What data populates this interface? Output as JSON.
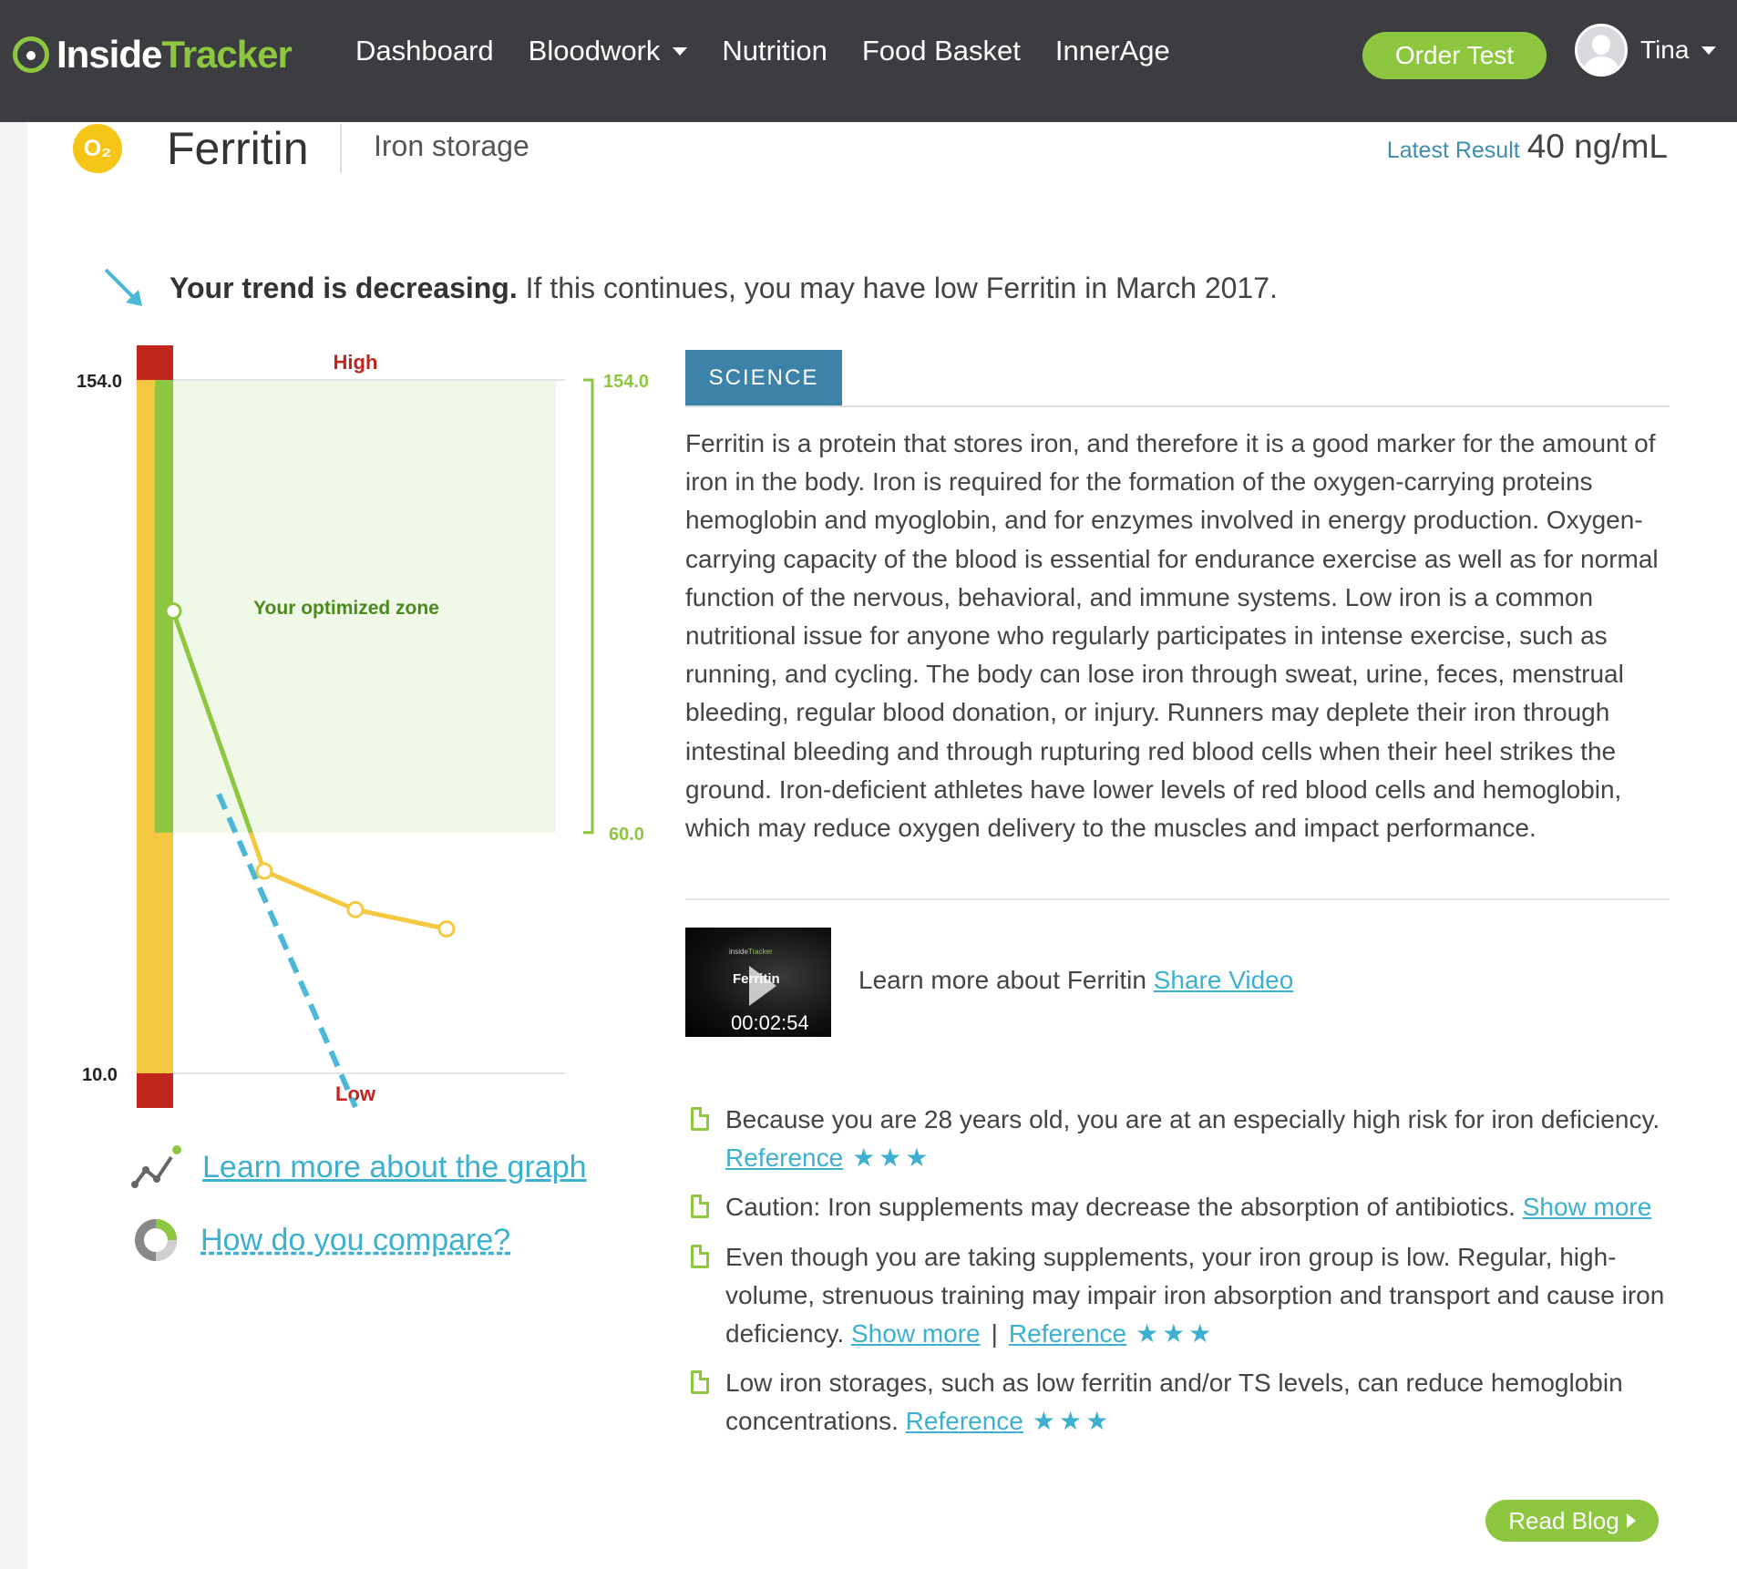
{
  "header": {
    "logo": {
      "part1": "Inside",
      "part2": "Tracker"
    },
    "nav": [
      {
        "label": "Dashboard",
        "dropdown": false
      },
      {
        "label": "Bloodwork",
        "dropdown": true
      },
      {
        "label": "Nutrition",
        "dropdown": false
      },
      {
        "label": "Food Basket",
        "dropdown": false
      },
      {
        "label": "InnerAge",
        "dropdown": false
      }
    ],
    "order_button": "Order Test",
    "user_name": "Tina"
  },
  "marker": {
    "badge": "O₂",
    "title": "Ferritin",
    "subtitle": "Iron storage",
    "latest_label": "Latest Result",
    "latest_value": "40 ng/mL"
  },
  "trend": {
    "bold": "Your trend is decreasing.",
    "rest": " If this continues, you may have low Ferritin in March 2017."
  },
  "chart_data": {
    "type": "line",
    "ylim": [
      10.0,
      154.0
    ],
    "y_ticks": [
      "154.0",
      "10.0"
    ],
    "zone_labels": {
      "high": "High",
      "low": "Low",
      "optimized": "Your optimized zone"
    },
    "optimized_range": {
      "low": 60.0,
      "high": 154.0,
      "low_label": "60.0",
      "high_label": "154.0"
    },
    "series": [
      {
        "values": [
          106,
          52,
          44,
          40
        ]
      }
    ],
    "trend_projection": [
      [
        0.5,
        68
      ],
      [
        2.0,
        3
      ]
    ],
    "colors": {
      "optimal": "#8dc63f",
      "normal": "#f5c842",
      "out_of_range": "#c0261d",
      "trend": "#4ab8d6"
    }
  },
  "links": {
    "learn_graph": "Learn more about the graph",
    "compare": "How do you compare?"
  },
  "science": {
    "tab": "SCIENCE",
    "text": "Ferritin is a protein that stores iron, and therefore it is a good marker for the amount of iron in the body. Iron is required for the formation of the oxygen-carrying proteins hemoglobin and myoglobin, and for enzymes involved in energy production. Oxygen-carrying capacity of the blood is essential for endurance exercise as well as for normal function of the nervous, behavioral, and immune systems. Low iron is a common nutritional issue for anyone who regularly participates in intense exercise, such as running, and cycling. The body can lose iron through sweat, urine, feces, menstrual bleeding, regular blood donation, or injury. Runners may deplete their iron through intestinal bleeding and through rupturing red blood cells when their heel strikes the ground. Iron-deficient athletes have lower levels of red blood cells and hemoglobin, which may reduce oxygen delivery to the muscles and impact performance."
  },
  "video": {
    "thumb_logo_1": "inside",
    "thumb_logo_2": "Tracker",
    "thumb_title": "Ferritin",
    "duration": "00:02:54",
    "caption": "Learn more about Ferritin ",
    "share": "Share Video"
  },
  "facts": [
    {
      "text": "Because you are 28 years old, you are at an especially high risk for iron deficiency. ",
      "reference": "Reference",
      "stars": "★★★"
    },
    {
      "text": "Caution: Iron supplements may decrease the absorption of antibiotics. ",
      "show_more": "Show more"
    },
    {
      "text": "Even though you are taking supplements, your iron group is low. Regular, high-volume, strenuous training may impair iron absorption and transport and cause iron deficiency. ",
      "show_more": "Show more",
      "separator": "|",
      "reference": "Reference",
      "stars": "★★★"
    },
    {
      "text": "Low iron storages, such as low ferritin and/or TS levels, can reduce hemoglobin concentrations. ",
      "reference": "Reference",
      "stars": "★★★"
    }
  ],
  "read_blog": "Read Blog"
}
